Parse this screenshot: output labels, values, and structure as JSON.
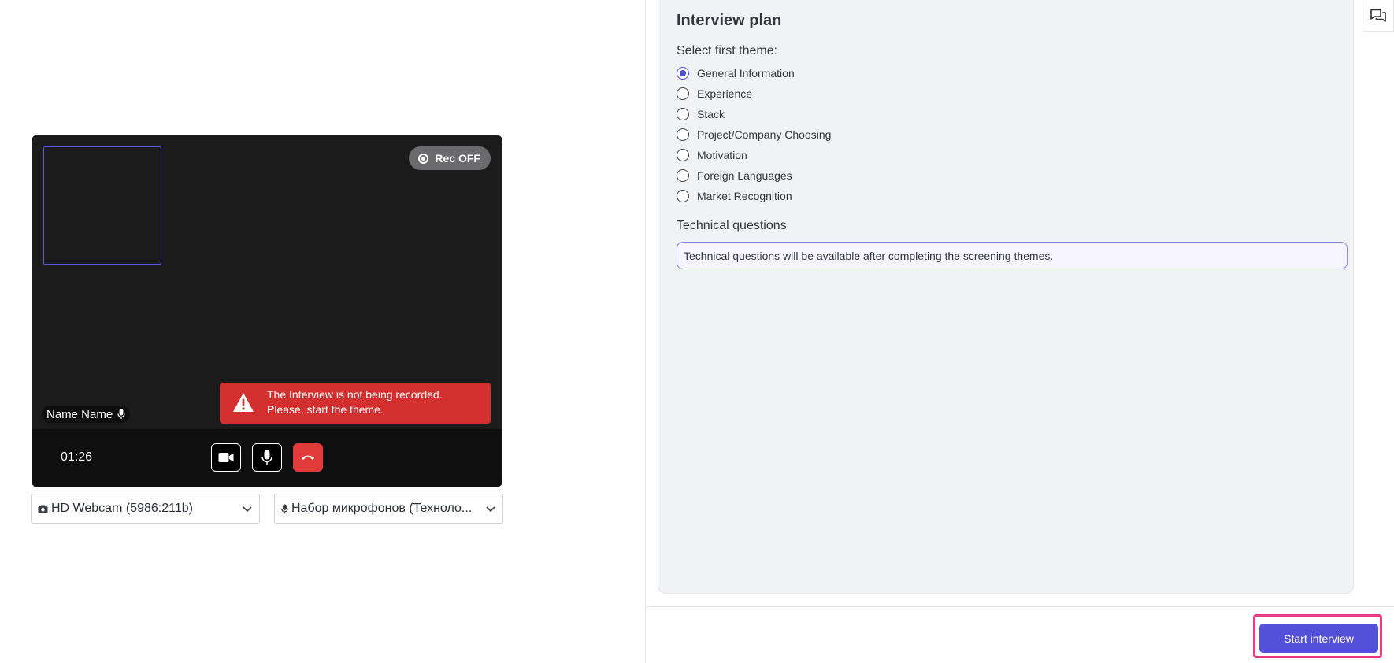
{
  "video": {
    "rec_label": "Rec OFF",
    "participant_name": "Name Name",
    "alert_line1": "The Interview is not being recorded.",
    "alert_line2": "Please, start the theme.",
    "timer": "01:26"
  },
  "devices": {
    "camera": "HD Webcam (5986:211b)",
    "microphone": "Набор микрофонов (Техноло..."
  },
  "plan": {
    "title": "Interview plan",
    "first_theme_label": "Select first theme:",
    "themes": [
      {
        "label": "General Information",
        "selected": true
      },
      {
        "label": "Experience",
        "selected": false
      },
      {
        "label": "Stack",
        "selected": false
      },
      {
        "label": "Project/Company Choosing",
        "selected": false
      },
      {
        "label": "Motivation",
        "selected": false
      },
      {
        "label": "Foreign Languages",
        "selected": false
      },
      {
        "label": "Market Recognition",
        "selected": false
      }
    ],
    "technical_label": "Technical questions",
    "technical_note": "Technical questions will be available after completing the screening themes."
  },
  "actions": {
    "start_label": "Start interview"
  },
  "colors": {
    "accent": "#5550d9",
    "alert": "#d32f2f",
    "highlight": "#ec3f83"
  }
}
